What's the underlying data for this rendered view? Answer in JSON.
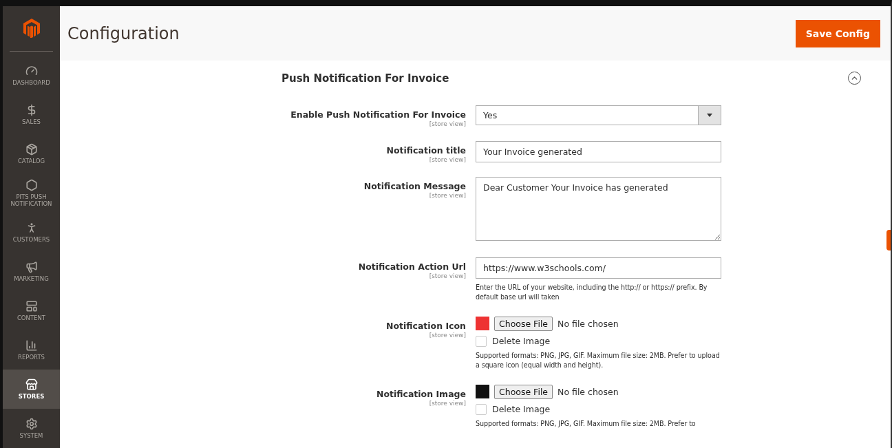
{
  "sidebar": {
    "items": [
      {
        "label": "DASHBOARD",
        "selected": false
      },
      {
        "label": "SALES",
        "selected": false
      },
      {
        "label": "CATALOG",
        "selected": false
      },
      {
        "label": "PITS PUSH NOTIFICATION",
        "selected": false
      },
      {
        "label": "CUSTOMERS",
        "selected": false
      },
      {
        "label": "MARKETING",
        "selected": false
      },
      {
        "label": "CONTENT",
        "selected": false
      },
      {
        "label": "REPORTS",
        "selected": false
      },
      {
        "label": "STORES",
        "selected": true
      },
      {
        "label": "SYSTEM",
        "selected": false
      }
    ]
  },
  "header": {
    "title": "Configuration",
    "save_button": "Save Config"
  },
  "section": {
    "title": "Push Notification For Invoice",
    "expanded": true,
    "fields": [
      {
        "kind": "select",
        "label": "Enable Push Notification For Invoice",
        "scope": "[store view]",
        "value": "Yes"
      },
      {
        "kind": "text",
        "label": "Notification title",
        "scope": "[store view]",
        "value": "Your Invoice generated"
      },
      {
        "kind": "textarea",
        "label": "Notification Message",
        "scope": "[store view]",
        "value": "Dear Customer Your Invoice has generated"
      },
      {
        "kind": "text",
        "label": "Notification Action Url",
        "scope": "[store view]",
        "value": "https://www.w3schools.com/",
        "note": "Enter the URL of your website, including the http:// or https:// prefix. By default base url will taken"
      },
      {
        "kind": "file",
        "label": "Notification Icon",
        "scope": "[store view]",
        "button": "Choose File",
        "status": "No file chosen",
        "delete_label": "Delete Image",
        "delete_checked": false,
        "note": "Supported formats: PNG, JPG, GIF. Maximum file size: 2MB. Prefer to upload a square icon (equal width and height)."
      },
      {
        "kind": "file",
        "label": "Notification Image",
        "scope": "[store view]",
        "button": "Choose File",
        "status": "No file chosen",
        "delete_label": "Delete Image",
        "delete_checked": false,
        "note": "Supported formats: PNG, JPG, GIF. Maximum file size: 2MB. Prefer to"
      }
    ]
  }
}
